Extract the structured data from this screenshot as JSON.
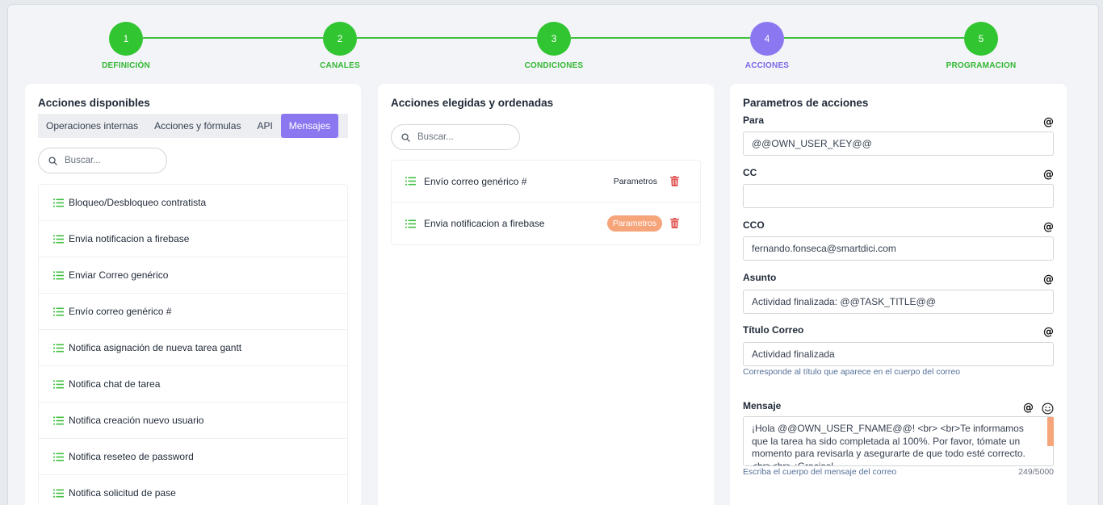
{
  "stepper": {
    "steps": [
      {
        "number": "1",
        "label": "DEFINICIÓN"
      },
      {
        "number": "2",
        "label": "CANALES"
      },
      {
        "number": "3",
        "label": "CONDICIONES"
      },
      {
        "number": "4",
        "label": "ACCIONES"
      },
      {
        "number": "5",
        "label": "PROGRAMACION"
      }
    ],
    "active_step": "4"
  },
  "available": {
    "title": "Acciones disponibles",
    "tabs": [
      "Operaciones internas",
      "Acciones y fórmulas",
      "API",
      "Mensajes"
    ],
    "active_tab": "Mensajes",
    "search_placeholder": "Buscar...",
    "items": [
      "Bloqueo/Desbloqueo contratista",
      "Envia notificacion a firebase",
      "Enviar Correo genérico",
      "Envío correo genérico #",
      "Notifica asignación de nueva tarea gantt",
      "Notifica chat de tarea",
      "Notifica creación nuevo usuario",
      "Notifica reseteo de password",
      "Notifica solicitud de pase"
    ]
  },
  "chosen": {
    "title": "Acciones elegidas y ordenadas",
    "search_placeholder": "Buscar...",
    "items": [
      {
        "label": "Envío correo genérico #",
        "button": "Parametros",
        "highlighted": false
      },
      {
        "label": "Envia notificacion a firebase",
        "button": "Parametros",
        "highlighted": true
      }
    ]
  },
  "params": {
    "title": "Parametros de acciones",
    "para": {
      "label": "Para",
      "value": "@@OWN_USER_KEY@@"
    },
    "cc": {
      "label": "CC",
      "value": ""
    },
    "cco": {
      "label": "CCO",
      "value": "fernando.fonseca@smartdici.com"
    },
    "asunto": {
      "label": "Asunto",
      "value": "Actividad finalizada: @@TASK_TITLE@@"
    },
    "titulo": {
      "label": "Título Correo",
      "value": "Actividad finalizada",
      "hint": "Corresponde al título que aparece en el cuerpo del correo"
    },
    "mensaje": {
      "label": "Mensaje",
      "value": "¡Hola @@OWN_USER_FNAME@@! <br> <br>Te informamos que la tarea ha sido completada al 100%. Por favor, tómate un momento para revisarla y asegurarte de que todo esté correcto. <br><br> ¡Gracias!",
      "hint": "Escriba el cuerpo del mensaje del correo",
      "counter": "249/5000"
    },
    "at_symbol": "@"
  },
  "colors": {
    "step_done": "#31c531",
    "step_active": "#8b78f0",
    "accent": "#8b78f0",
    "highlight": "#f6a47a",
    "trash": "#e25555"
  }
}
